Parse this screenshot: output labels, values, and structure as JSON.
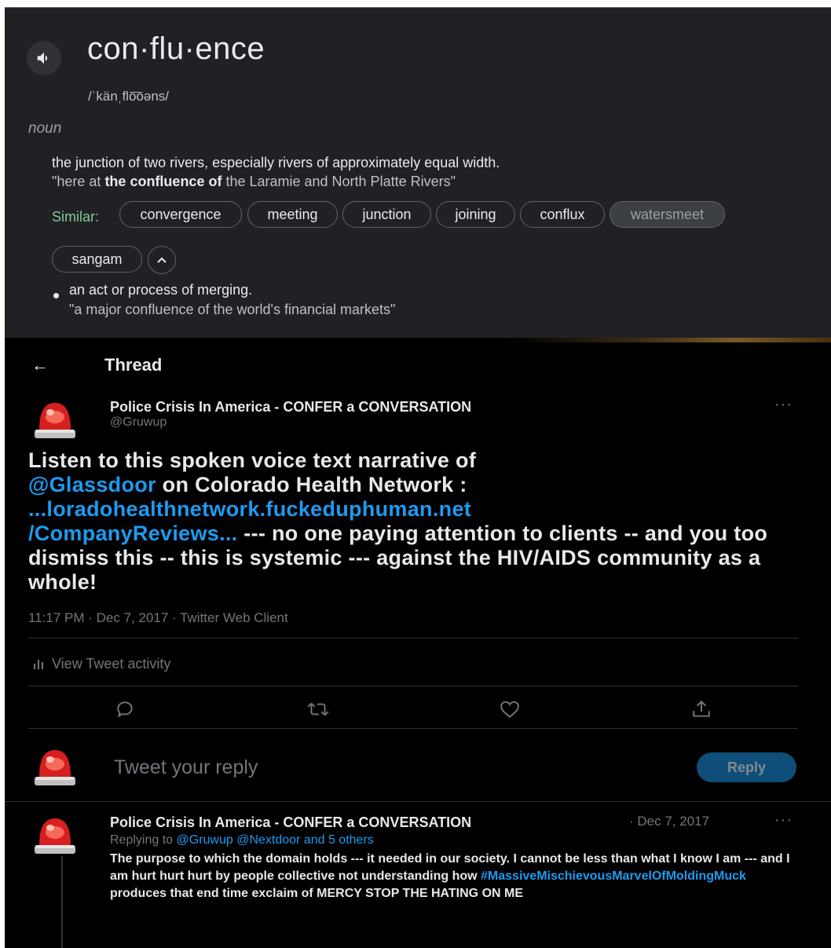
{
  "dictionary": {
    "word": "con·flu·ence",
    "pronunciation": "/ˈkänˌflo͞oəns/",
    "part_of_speech": "noun",
    "definitions": [
      {
        "text": "the junction of two rivers, especially rivers of approximately equal width.",
        "example_prefix": "\"here at ",
        "example_bold": "the confluence of",
        "example_suffix": " the Laramie and North Platte Rivers\""
      },
      {
        "text": "an act or process of merging.",
        "example": "\"a major confluence of the world's financial markets\""
      }
    ],
    "similar_label": "Similar:",
    "similar": [
      "convergence",
      "meeting",
      "junction",
      "joining",
      "conflux",
      "watersmeet",
      "sangam"
    ],
    "icons": {
      "speaker": "speaker-icon",
      "collapse": "chevron-up-icon"
    }
  },
  "twitter": {
    "header": {
      "back": "←",
      "title": "Thread"
    },
    "tweet": {
      "author": "Police Crisis In America - CONFER a CONVERSATION",
      "handle": "@Gruwup",
      "more": "···",
      "text_1": "Listen to this spoken voice text narrative of",
      "mention": "@Glassdoor",
      "text_2": " on Colorado Health Network :",
      "link_1": "...loradohealthnetwork.fuckeduphuman.net",
      "link_2": "/CompanyReviews...",
      "text_3": " --- no one paying attention to clients -- and you too dismiss this -- this is systemic --- against the HIV/AIDS community as a whole!",
      "meta": "11:17 PM · Dec 7, 2017 · Twitter Web Client",
      "activity": "View Tweet activity"
    },
    "actions": [
      "reply-icon",
      "retweet-icon",
      "like-icon",
      "share-icon"
    ],
    "composer": {
      "placeholder": "Tweet your reply",
      "button": "Reply"
    },
    "reply": {
      "author": "Police Crisis In America - CONFER a CONVERSATION",
      "date": "· Dec 7, 2017",
      "more": "···",
      "replying_prefix": "Replying to ",
      "replying_to": "@Gruwup @Nextdoor and 5 others",
      "body_1": "The purpose to which the domain holds --- it needed in our society.   I cannot be less than what I know I am --- and I am hurt hurt hurt by people collective not understanding how ",
      "hashtag": "#MassiveMischievousMarvelOfMoldingMuck",
      "body_2": " produces that end time exclaim of MERCY STOP THE HATING ON ME"
    },
    "colors": {
      "link": "#1d9bf0",
      "background": "#000000",
      "muted": "#71767b"
    }
  }
}
